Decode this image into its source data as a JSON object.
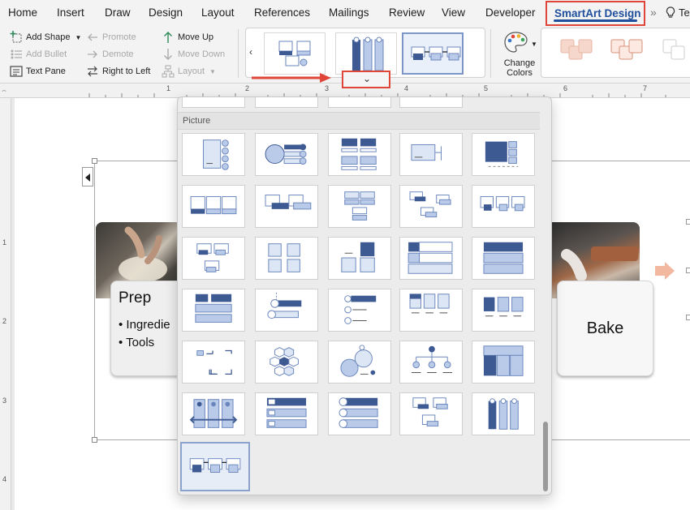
{
  "tabs": [
    {
      "id": "home",
      "label": "Home"
    },
    {
      "id": "insert",
      "label": "Insert"
    },
    {
      "id": "draw",
      "label": "Draw"
    },
    {
      "id": "design",
      "label": "Design"
    },
    {
      "id": "layout",
      "label": "Layout"
    },
    {
      "id": "references",
      "label": "References"
    },
    {
      "id": "mailings",
      "label": "Mailings"
    },
    {
      "id": "review",
      "label": "Review"
    },
    {
      "id": "view",
      "label": "View"
    },
    {
      "id": "developer",
      "label": "Developer"
    }
  ],
  "active_tab": "SmartArt Design",
  "tell_me": "Te",
  "ribbon": {
    "add_shape": "Add Shape",
    "add_bullet": "Add Bullet",
    "text_pane": "Text Pane",
    "promote": "Promote",
    "demote": "Demote",
    "right_to_left": "Right to Left",
    "move_up": "Move Up",
    "move_down": "Move Down",
    "layout": "Layout",
    "change_colors": "Change Colors"
  },
  "ruler": {
    "h": [
      "1",
      "2",
      "3",
      "4",
      "5",
      "6",
      "7"
    ],
    "v": [
      "1",
      "2",
      "3",
      "4"
    ]
  },
  "document": {
    "prep_title": "Prep",
    "prep_bullets": [
      "Ingredie",
      "Tools"
    ],
    "bake_title": "Bake"
  },
  "gallery": {
    "section": "Picture",
    "rows": 6,
    "cols": 5,
    "extra": 1
  },
  "colors": {
    "accent": "#3e5a93",
    "light": "#b9cbe8",
    "highlight": "#e0453a",
    "tab_active": "#1f4f9c"
  }
}
